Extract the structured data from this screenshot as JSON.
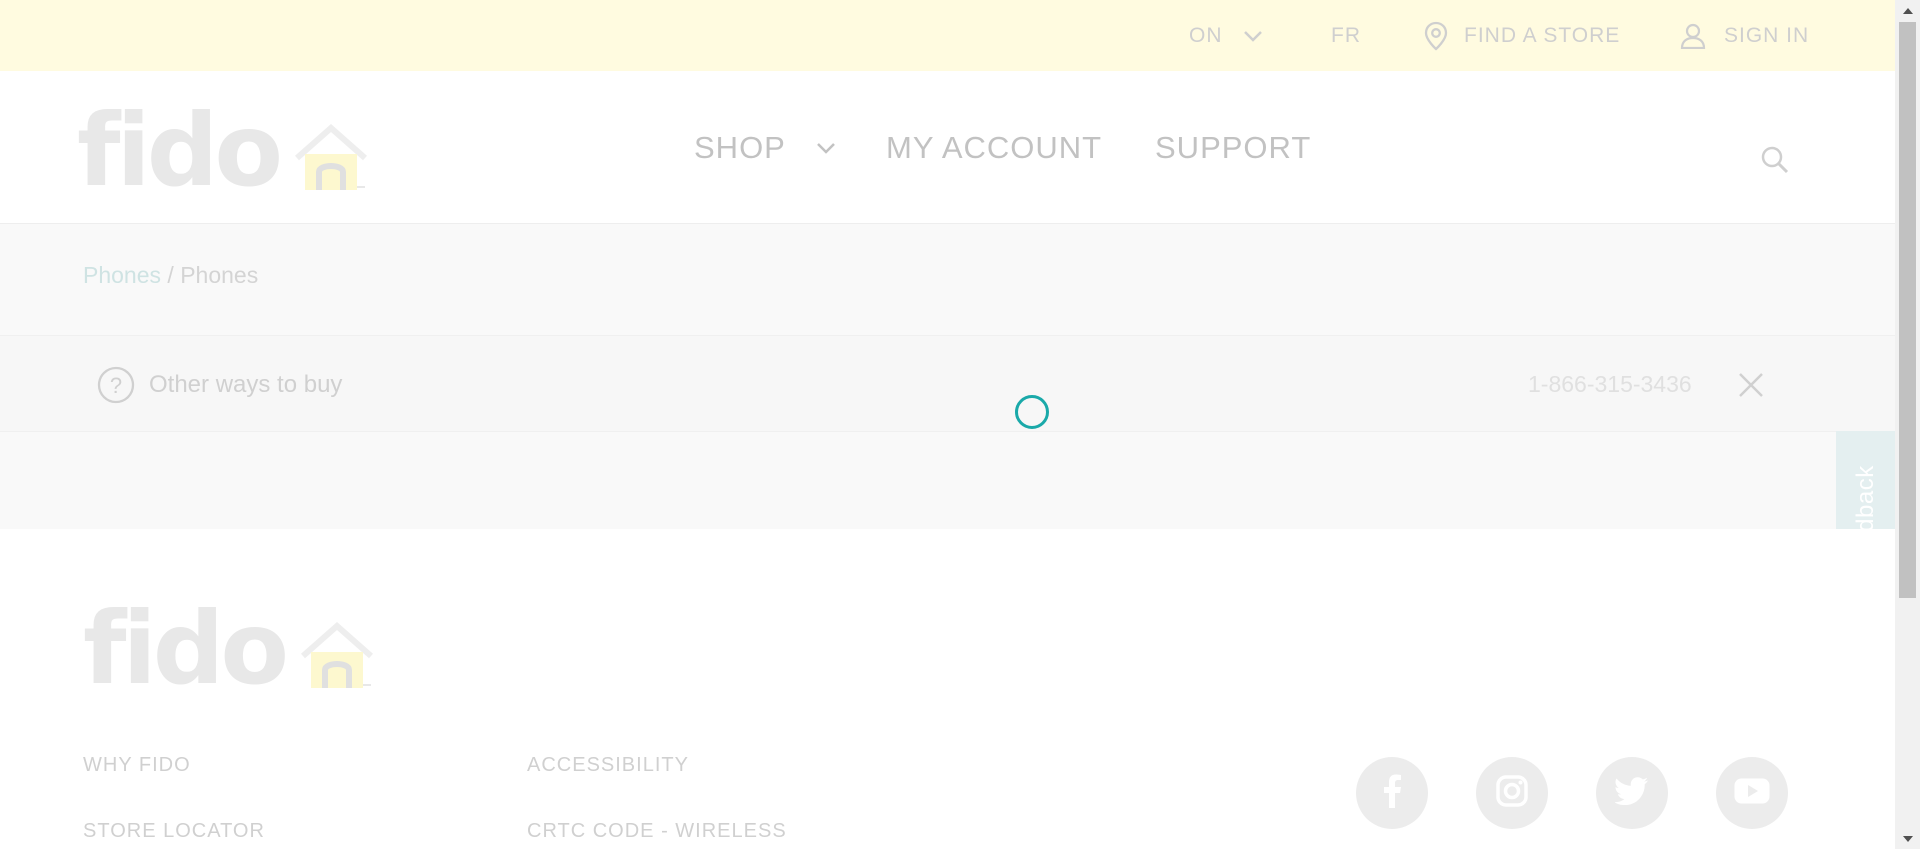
{
  "utility": {
    "province": "ON",
    "language": "FR",
    "find_store": "FIND A STORE",
    "sign_in": "SIGN IN"
  },
  "header": {
    "logo_text": "fido",
    "nav": {
      "shop": "SHOP",
      "my_account": "MY ACCOUNT",
      "support": "SUPPORT"
    }
  },
  "breadcrumb": {
    "parent": "Phones",
    "separator": " / ",
    "current": "Phones"
  },
  "buy_bar": {
    "label": "Other ways to buy",
    "phone": "1-866-315-3436"
  },
  "feedback": {
    "label": "Feedback"
  },
  "footer": {
    "logo_text": "fido",
    "links": {
      "why_fido": "WHY FIDO",
      "store_locator": "STORE LOCATOR",
      "accessibility": "ACCESSIBILITY",
      "crtc_code": "CRTC CODE - WIRELESS"
    },
    "social_icons": [
      "facebook-icon",
      "instagram-icon",
      "twitter-icon",
      "youtube-icon"
    ]
  },
  "colors": {
    "utility_bar_bg": "#fffbe0",
    "spinner": "#1aa9a9",
    "feedback_tab": "#e4eff0",
    "logo_house": "#f7f0b8"
  }
}
